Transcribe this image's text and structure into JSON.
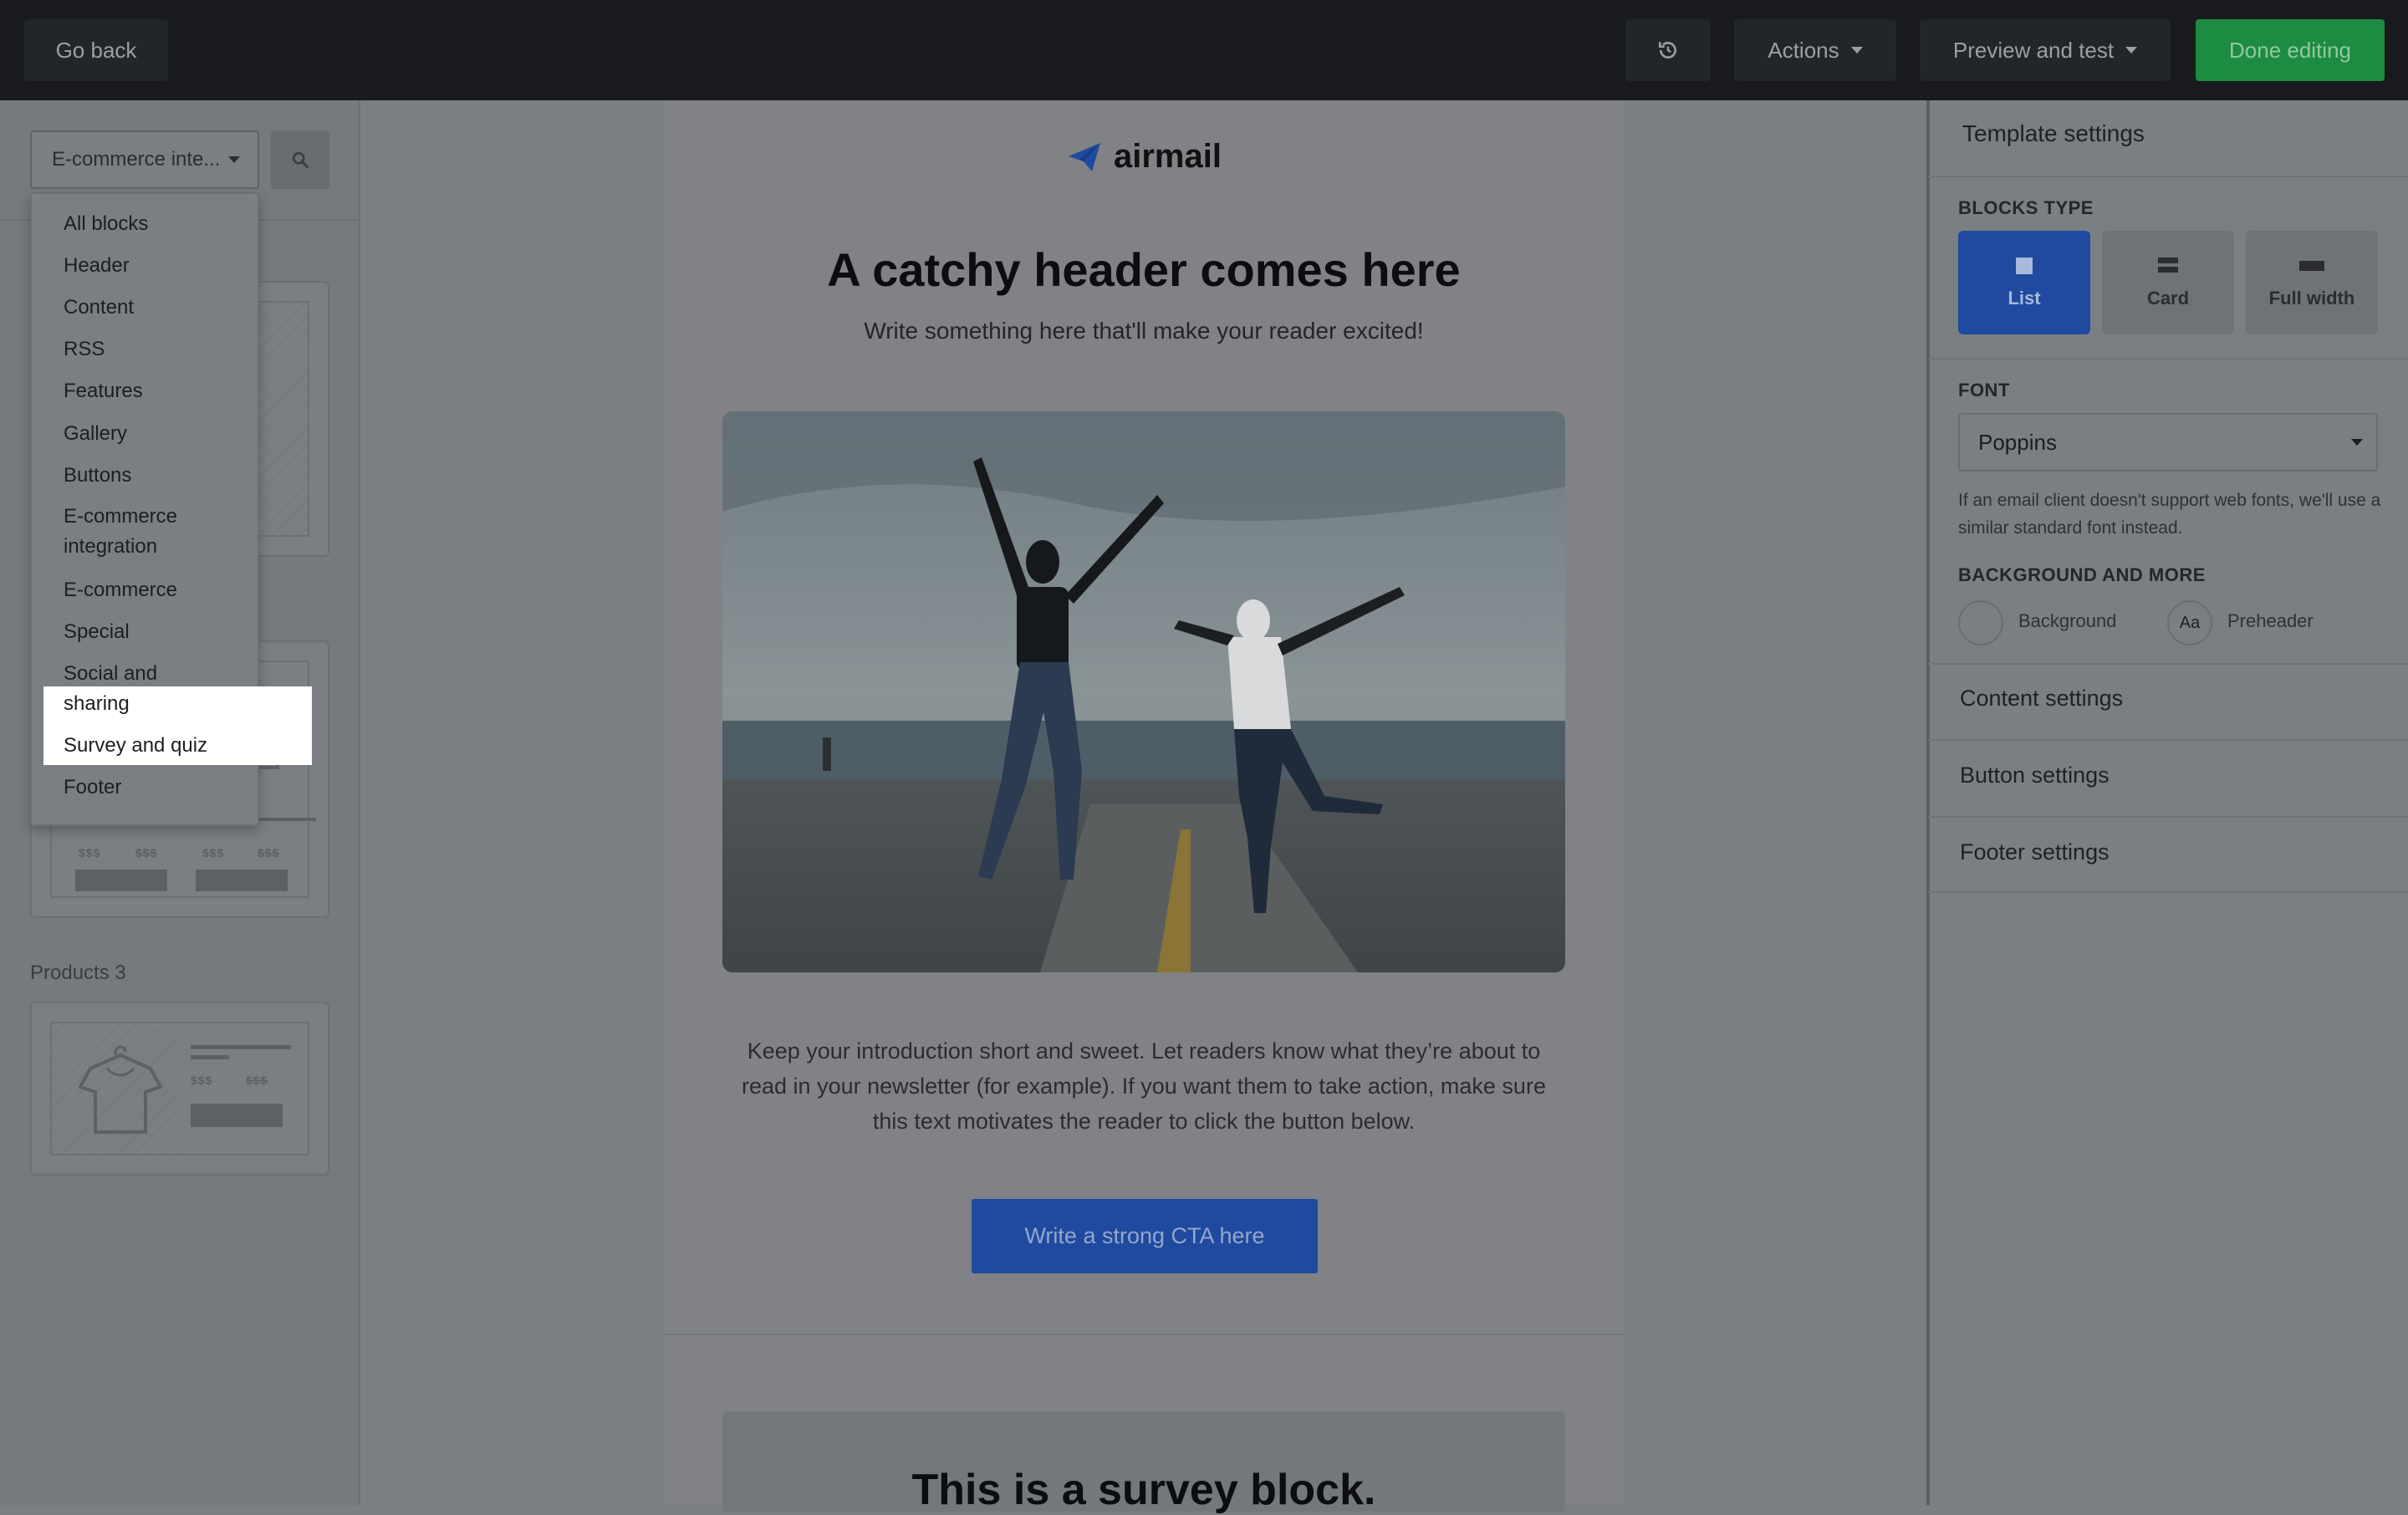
{
  "topbar": {
    "go_back": "Go back",
    "history_icon": "history-icon",
    "actions": "Actions",
    "preview_and_test": "Preview and test",
    "done_editing": "Done editing"
  },
  "left_panel": {
    "category_select_value": "E-commerce inte...",
    "search_icon": "search-icon",
    "cards": [
      {
        "label": "Products 3"
      }
    ],
    "dropdown": {
      "items": [
        "All blocks",
        "Header",
        "Content",
        "RSS",
        "Features",
        "Gallery",
        "Buttons",
        "E-commerce integration",
        "E-commerce",
        "Special",
        "Social and sharing",
        "Survey and quiz",
        "Footer"
      ],
      "selected": "E-commerce integration"
    },
    "price_placeholder": "$$$"
  },
  "email": {
    "logo_text": "airmail",
    "header": "A catchy header comes here",
    "subheader": "Write something here that'll make your reader excited!",
    "intro": "Keep your introduction short and sweet. Let readers know what they’re about to read in your newsletter (for example). If you want them to take action, make sure this text motivates the reader to click the button below.",
    "cta": "Write a strong CTA here",
    "survey_header": "This is a survey block."
  },
  "right_panel": {
    "title": "Template settings",
    "blocks_type_label": "BLOCKS TYPE",
    "block_types": [
      "List",
      "Card",
      "Full width"
    ],
    "active_block_type": "List",
    "font_label": "FONT",
    "font_value": "Poppins",
    "font_note": "If an email client doesn't support web fonts, we'll use a similar standard font instead.",
    "background_label": "BACKGROUND AND MORE",
    "background": "Background",
    "preheader": "Preheader",
    "preheader_badge": "Aa",
    "sections": [
      "Content settings",
      "Button settings",
      "Footer settings"
    ]
  },
  "colors": {
    "topbar": "#181a1d",
    "primary_blue": "#1f4aa0",
    "done_green": "#1d8b41",
    "overlay_gray": "#7b7e83"
  }
}
